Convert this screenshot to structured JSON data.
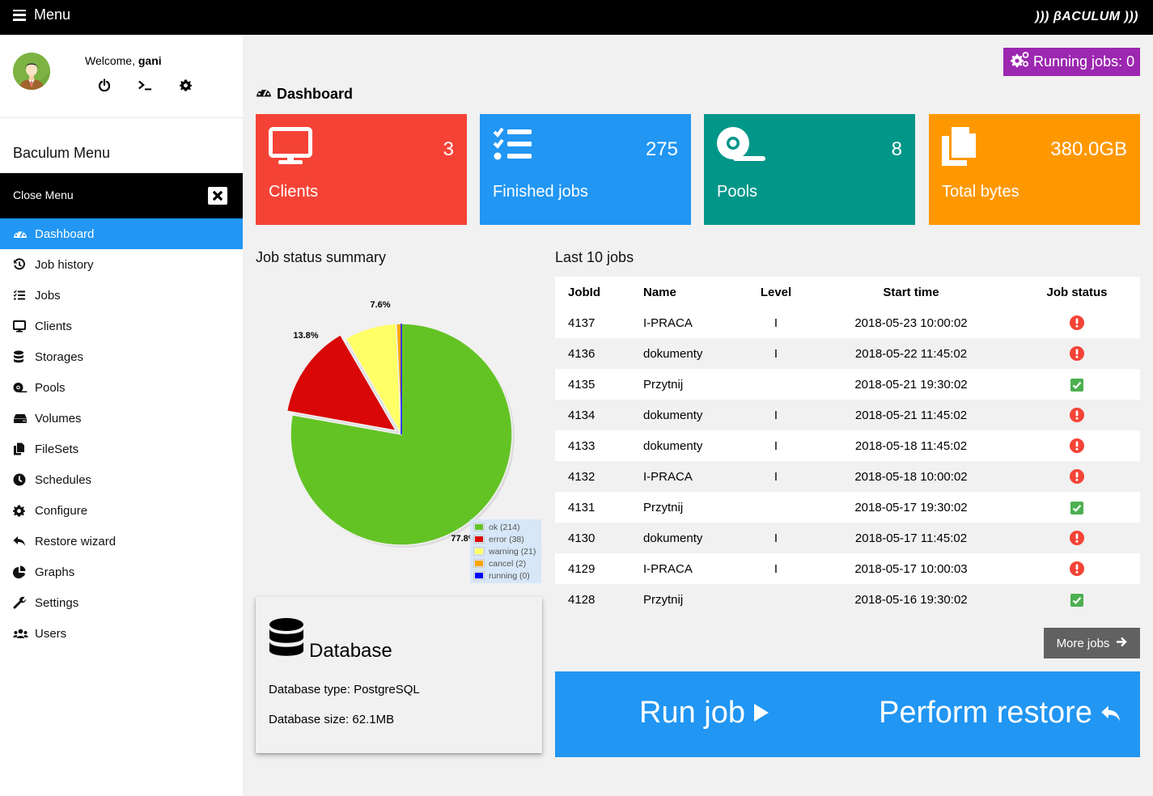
{
  "topbar": {
    "menu_label": "Menu",
    "logo": "))) βACULUM )))"
  },
  "user": {
    "welcome_prefix": "Welcome, ",
    "username": "gani"
  },
  "sidebar": {
    "title": "Baculum Menu",
    "close_label": "Close Menu",
    "items": [
      {
        "label": "Dashboard",
        "icon": "tachometer-icon",
        "active": true
      },
      {
        "label": "Job history",
        "icon": "history-icon"
      },
      {
        "label": "Jobs",
        "icon": "tasks-icon"
      },
      {
        "label": "Clients",
        "icon": "desktop-icon"
      },
      {
        "label": "Storages",
        "icon": "database-icon"
      },
      {
        "label": "Pools",
        "icon": "tape-icon"
      },
      {
        "label": "Volumes",
        "icon": "hdd-icon"
      },
      {
        "label": "FileSets",
        "icon": "copy-icon"
      },
      {
        "label": "Schedules",
        "icon": "clock-icon"
      },
      {
        "label": "Configure",
        "icon": "cog-icon"
      },
      {
        "label": "Restore wizard",
        "icon": "reply-icon"
      },
      {
        "label": "Graphs",
        "icon": "chart-pie-icon"
      },
      {
        "label": "Settings",
        "icon": "wrench-icon"
      },
      {
        "label": "Users",
        "icon": "users-icon"
      }
    ]
  },
  "header": {
    "running_jobs": "Running jobs: 0",
    "page_title": "Dashboard"
  },
  "tiles": [
    {
      "label": "Clients",
      "value": "3",
      "color": "#f44336",
      "icon": "desktop-icon"
    },
    {
      "label": "Finished jobs",
      "value": "275",
      "color": "#2196f3",
      "icon": "tasks-icon"
    },
    {
      "label": "Pools",
      "value": "8",
      "color": "#009688",
      "icon": "tape-icon"
    },
    {
      "label": "Total bytes",
      "value": "380.0GB",
      "color": "#ff9800",
      "icon": "copy-icon"
    }
  ],
  "summary": {
    "title": "Job status summary",
    "chart_data": {
      "type": "pie",
      "title": "Job status summary",
      "categories": [
        "ok",
        "error",
        "warning",
        "cancel",
        "running"
      ],
      "values": [
        214,
        38,
        21,
        2,
        0
      ],
      "colors": [
        "#63c324",
        "#d90707",
        "#ffff66",
        "#ffa500",
        "#0000ff"
      ],
      "legend": [
        "ok (214)",
        "error (38)",
        "warning (21)",
        "cancel (2)",
        "running (0)"
      ],
      "slice_labels": [
        "77.8%",
        "13.8%",
        "7.6%",
        "",
        ""
      ],
      "legend_position": "bottom-right"
    }
  },
  "database": {
    "title": "Database",
    "type_line": "Database type: PostgreSQL",
    "size_line": "Database size: 62.1MB"
  },
  "last_jobs": {
    "title": "Last 10 jobs",
    "columns": [
      "JobId",
      "Name",
      "Level",
      "Start time",
      "Job status"
    ],
    "rows": [
      {
        "id": "4137",
        "name": "I-PRACA",
        "level": "I",
        "start": "2018-05-23 10:00:02",
        "status": "error"
      },
      {
        "id": "4136",
        "name": "dokumenty",
        "level": "I",
        "start": "2018-05-22 11:45:02",
        "status": "error"
      },
      {
        "id": "4135",
        "name": "Przytnij",
        "level": "",
        "start": "2018-05-21 19:30:02",
        "status": "ok"
      },
      {
        "id": "4134",
        "name": "dokumenty",
        "level": "I",
        "start": "2018-05-21 11:45:02",
        "status": "error"
      },
      {
        "id": "4133",
        "name": "dokumenty",
        "level": "I",
        "start": "2018-05-18 11:45:02",
        "status": "error"
      },
      {
        "id": "4132",
        "name": "I-PRACA",
        "level": "I",
        "start": "2018-05-18 10:00:02",
        "status": "error"
      },
      {
        "id": "4131",
        "name": "Przytnij",
        "level": "",
        "start": "2018-05-17 19:30:02",
        "status": "ok"
      },
      {
        "id": "4130",
        "name": "dokumenty",
        "level": "I",
        "start": "2018-05-17 11:45:02",
        "status": "error"
      },
      {
        "id": "4129",
        "name": "I-PRACA",
        "level": "I",
        "start": "2018-05-17 10:00:03",
        "status": "error"
      },
      {
        "id": "4128",
        "name": "Przytnij",
        "level": "",
        "start": "2018-05-16 19:30:02",
        "status": "ok"
      }
    ],
    "more_label": "More jobs"
  },
  "actions": {
    "run_job": "Run job",
    "perform_restore": "Perform restore"
  },
  "colors": {
    "accent": "#2196f3",
    "error": "#f44336",
    "ok": "#4caf50",
    "running": "#9c27b0"
  }
}
